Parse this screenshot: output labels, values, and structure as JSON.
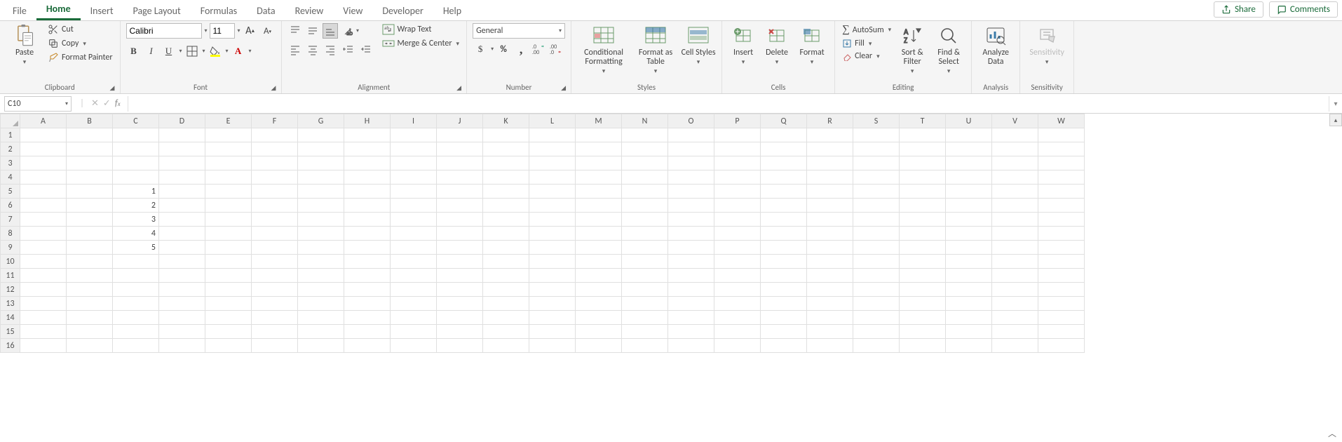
{
  "tabs": {
    "file": "File",
    "home": "Home",
    "insert": "Insert",
    "pagelayout": "Page Layout",
    "formulas": "Formulas",
    "data": "Data",
    "review": "Review",
    "view": "View",
    "developer": "Developer",
    "help": "Help"
  },
  "top_right": {
    "share": "Share",
    "comments": "Comments"
  },
  "ribbon": {
    "clipboard": {
      "label": "Clipboard",
      "paste": "Paste",
      "cut": "Cut",
      "copy": "Copy",
      "fmt_painter": "Format Painter"
    },
    "font": {
      "label": "Font",
      "name": "Calibri",
      "size": "11"
    },
    "alignment": {
      "label": "Alignment",
      "wrap": "Wrap Text",
      "merge": "Merge & Center"
    },
    "number": {
      "label": "Number",
      "fmt": "General"
    },
    "styles": {
      "label": "Styles",
      "cond": "Conditional Formatting",
      "table": "Format as Table",
      "cell": "Cell Styles"
    },
    "cells": {
      "label": "Cells",
      "insert": "Insert",
      "delete": "Delete",
      "format": "Format"
    },
    "editing": {
      "label": "Editing",
      "autosum": "AutoSum",
      "fill": "Fill",
      "clear": "Clear",
      "sortfilter": "Sort & Filter",
      "findselect": "Find & Select"
    },
    "analysis": {
      "label": "Analysis",
      "analyze": "Analyze Data"
    },
    "sensitivity": {
      "label": "Sensitivity",
      "sens": "Sensitivity"
    }
  },
  "namebox": "C10",
  "formula": "",
  "columns": [
    "A",
    "B",
    "C",
    "D",
    "E",
    "F",
    "G",
    "H",
    "I",
    "J",
    "K",
    "L",
    "M",
    "N",
    "O",
    "P",
    "Q",
    "R",
    "S",
    "T",
    "U",
    "V",
    "W"
  ],
  "rows": [
    1,
    2,
    3,
    4,
    5,
    6,
    7,
    8,
    9,
    10,
    11,
    12,
    13,
    14,
    15,
    16
  ],
  "cells": {
    "C5": "1",
    "C6": "2",
    "C7": "3",
    "C8": "4",
    "C9": "5"
  }
}
